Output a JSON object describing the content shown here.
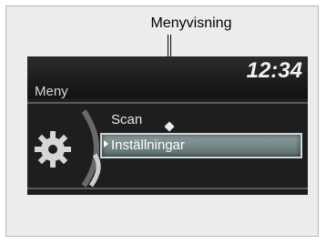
{
  "callout": {
    "label": "Menyvisning"
  },
  "screen": {
    "clock": "12:34",
    "title": "Meny",
    "menu": [
      {
        "label": "Scan",
        "selected": false
      },
      {
        "label": "Inställningar",
        "selected": true
      }
    ],
    "icon": "gear-icon"
  }
}
